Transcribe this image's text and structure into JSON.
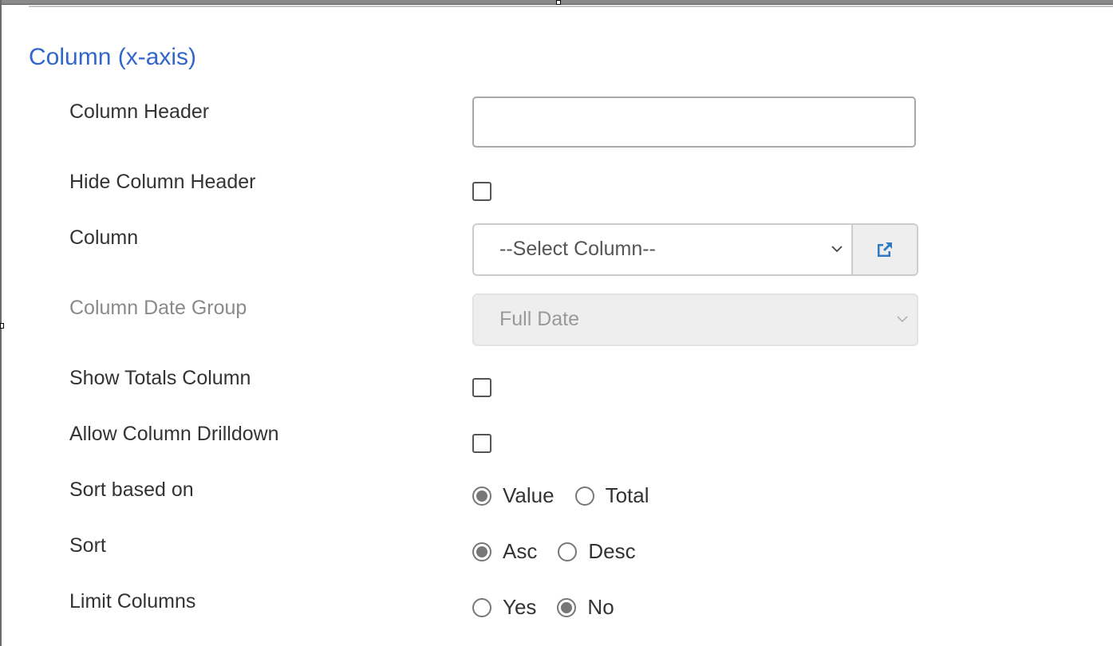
{
  "section_title": "Column (x-axis)",
  "fields": {
    "column_header": {
      "label": "Column Header",
      "value": "",
      "placeholder": ""
    },
    "hide_column_header": {
      "label": "Hide Column Header",
      "checked": false
    },
    "column": {
      "label": "Column",
      "selected": "--Select Column--",
      "addon_icon": "external-link-icon"
    },
    "column_date_group": {
      "label": "Column Date Group",
      "selected": "Full Date",
      "disabled": true
    },
    "show_totals_column": {
      "label": "Show Totals Column",
      "checked": false
    },
    "allow_column_drilldown": {
      "label": "Allow Column Drilldown",
      "checked": false
    },
    "sort_based_on": {
      "label": "Sort based on",
      "options": [
        "Value",
        "Total"
      ],
      "selected": "Value"
    },
    "sort": {
      "label": "Sort",
      "options": [
        "Asc",
        "Desc"
      ],
      "selected": "Asc"
    },
    "limit_columns": {
      "label": "Limit Columns",
      "options": [
        "Yes",
        "No"
      ],
      "selected": "No"
    }
  },
  "colors": {
    "title": "#3366cc",
    "icon": "#2e7bc4"
  }
}
